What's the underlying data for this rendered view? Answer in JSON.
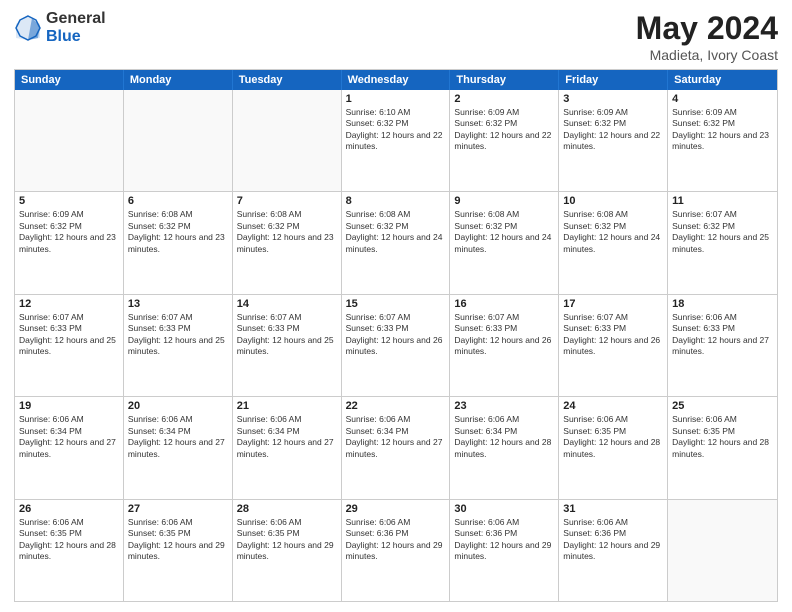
{
  "logo": {
    "general": "General",
    "blue": "Blue"
  },
  "header": {
    "title": "May 2024",
    "subtitle": "Madieta, Ivory Coast"
  },
  "dayHeaders": [
    "Sunday",
    "Monday",
    "Tuesday",
    "Wednesday",
    "Thursday",
    "Friday",
    "Saturday"
  ],
  "weeks": [
    {
      "days": [
        {
          "num": "",
          "info": ""
        },
        {
          "num": "",
          "info": ""
        },
        {
          "num": "",
          "info": ""
        },
        {
          "num": "1",
          "info": "Sunrise: 6:10 AM\nSunset: 6:32 PM\nDaylight: 12 hours and 22 minutes."
        },
        {
          "num": "2",
          "info": "Sunrise: 6:09 AM\nSunset: 6:32 PM\nDaylight: 12 hours and 22 minutes."
        },
        {
          "num": "3",
          "info": "Sunrise: 6:09 AM\nSunset: 6:32 PM\nDaylight: 12 hours and 22 minutes."
        },
        {
          "num": "4",
          "info": "Sunrise: 6:09 AM\nSunset: 6:32 PM\nDaylight: 12 hours and 23 minutes."
        }
      ]
    },
    {
      "days": [
        {
          "num": "5",
          "info": "Sunrise: 6:09 AM\nSunset: 6:32 PM\nDaylight: 12 hours and 23 minutes."
        },
        {
          "num": "6",
          "info": "Sunrise: 6:08 AM\nSunset: 6:32 PM\nDaylight: 12 hours and 23 minutes."
        },
        {
          "num": "7",
          "info": "Sunrise: 6:08 AM\nSunset: 6:32 PM\nDaylight: 12 hours and 23 minutes."
        },
        {
          "num": "8",
          "info": "Sunrise: 6:08 AM\nSunset: 6:32 PM\nDaylight: 12 hours and 24 minutes."
        },
        {
          "num": "9",
          "info": "Sunrise: 6:08 AM\nSunset: 6:32 PM\nDaylight: 12 hours and 24 minutes."
        },
        {
          "num": "10",
          "info": "Sunrise: 6:08 AM\nSunset: 6:32 PM\nDaylight: 12 hours and 24 minutes."
        },
        {
          "num": "11",
          "info": "Sunrise: 6:07 AM\nSunset: 6:32 PM\nDaylight: 12 hours and 25 minutes."
        }
      ]
    },
    {
      "days": [
        {
          "num": "12",
          "info": "Sunrise: 6:07 AM\nSunset: 6:33 PM\nDaylight: 12 hours and 25 minutes."
        },
        {
          "num": "13",
          "info": "Sunrise: 6:07 AM\nSunset: 6:33 PM\nDaylight: 12 hours and 25 minutes."
        },
        {
          "num": "14",
          "info": "Sunrise: 6:07 AM\nSunset: 6:33 PM\nDaylight: 12 hours and 25 minutes."
        },
        {
          "num": "15",
          "info": "Sunrise: 6:07 AM\nSunset: 6:33 PM\nDaylight: 12 hours and 26 minutes."
        },
        {
          "num": "16",
          "info": "Sunrise: 6:07 AM\nSunset: 6:33 PM\nDaylight: 12 hours and 26 minutes."
        },
        {
          "num": "17",
          "info": "Sunrise: 6:07 AM\nSunset: 6:33 PM\nDaylight: 12 hours and 26 minutes."
        },
        {
          "num": "18",
          "info": "Sunrise: 6:06 AM\nSunset: 6:33 PM\nDaylight: 12 hours and 27 minutes."
        }
      ]
    },
    {
      "days": [
        {
          "num": "19",
          "info": "Sunrise: 6:06 AM\nSunset: 6:34 PM\nDaylight: 12 hours and 27 minutes."
        },
        {
          "num": "20",
          "info": "Sunrise: 6:06 AM\nSunset: 6:34 PM\nDaylight: 12 hours and 27 minutes."
        },
        {
          "num": "21",
          "info": "Sunrise: 6:06 AM\nSunset: 6:34 PM\nDaylight: 12 hours and 27 minutes."
        },
        {
          "num": "22",
          "info": "Sunrise: 6:06 AM\nSunset: 6:34 PM\nDaylight: 12 hours and 27 minutes."
        },
        {
          "num": "23",
          "info": "Sunrise: 6:06 AM\nSunset: 6:34 PM\nDaylight: 12 hours and 28 minutes."
        },
        {
          "num": "24",
          "info": "Sunrise: 6:06 AM\nSunset: 6:35 PM\nDaylight: 12 hours and 28 minutes."
        },
        {
          "num": "25",
          "info": "Sunrise: 6:06 AM\nSunset: 6:35 PM\nDaylight: 12 hours and 28 minutes."
        }
      ]
    },
    {
      "days": [
        {
          "num": "26",
          "info": "Sunrise: 6:06 AM\nSunset: 6:35 PM\nDaylight: 12 hours and 28 minutes."
        },
        {
          "num": "27",
          "info": "Sunrise: 6:06 AM\nSunset: 6:35 PM\nDaylight: 12 hours and 29 minutes."
        },
        {
          "num": "28",
          "info": "Sunrise: 6:06 AM\nSunset: 6:35 PM\nDaylight: 12 hours and 29 minutes."
        },
        {
          "num": "29",
          "info": "Sunrise: 6:06 AM\nSunset: 6:36 PM\nDaylight: 12 hours and 29 minutes."
        },
        {
          "num": "30",
          "info": "Sunrise: 6:06 AM\nSunset: 6:36 PM\nDaylight: 12 hours and 29 minutes."
        },
        {
          "num": "31",
          "info": "Sunrise: 6:06 AM\nSunset: 6:36 PM\nDaylight: 12 hours and 29 minutes."
        },
        {
          "num": "",
          "info": ""
        }
      ]
    }
  ]
}
